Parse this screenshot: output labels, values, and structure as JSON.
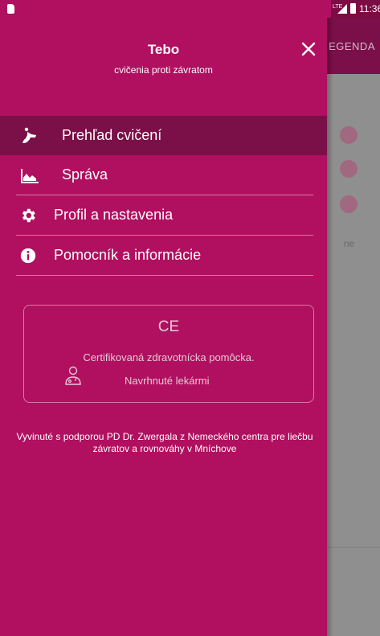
{
  "status_bar": {
    "network": "LTE",
    "time": "11:36"
  },
  "drawer": {
    "title": "Tebo",
    "subtitle": "cvičenia proti závratom",
    "menu": [
      {
        "label": "Prehľad cvičení",
        "icon": "exercise-icon",
        "active": true
      },
      {
        "label": "Správa",
        "icon": "chart-icon",
        "active": false
      },
      {
        "label": "Profil a nastavenia",
        "icon": "gear-icon",
        "active": false
      },
      {
        "label": "Pomocník a informácie",
        "icon": "info-icon",
        "active": false
      }
    ],
    "certification": {
      "mark": "CE",
      "line1": "Certifikovaná zdravotnícka pomôcka.",
      "line2": "Navrhnuté lekármi"
    },
    "footer": "Vyvinuté s podporou PD Dr. Zwergala z Nemeckého centra pre liečbu závratov a rovnováhy v Mníchove"
  },
  "background": {
    "tab_label": "EGENDA",
    "text_fragment": "ne"
  },
  "colors": {
    "drawer_bg": "#b0105f",
    "active_item": "#7b0f47",
    "scrim": "#8f8f8f"
  }
}
